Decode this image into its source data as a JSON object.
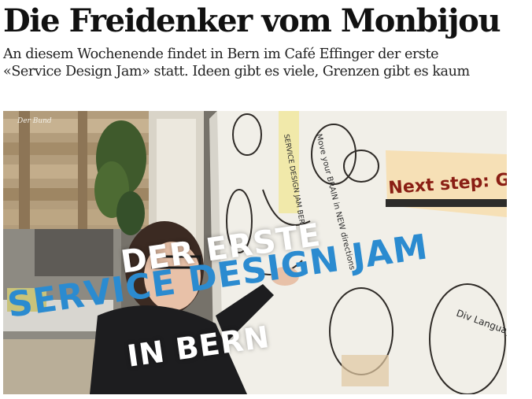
{
  "article": {
    "headline": "Die Freidenker vom Monbijou",
    "lead_line1": "An diesem Wochenende findet in Bern im Café Effinger der erste",
    "lead_line2": "«Service Design Jam» statt. Ideen gibt es viele, Grenzen gibt es kaum"
  },
  "video": {
    "logo": "Der Bund",
    "overlay_line1": "DER ERSTE",
    "overlay_line2": "SERVICE DESIGN JAM",
    "overlay_line3": "IN BERN",
    "board_title": "SERVICE DESIGN JAM BERN",
    "board_next_step": "Next step: Go out",
    "board_brain": "Move your BRAIN in NEW directions",
    "board_language": "Div Language",
    "colors": {
      "overlay_blue": "#2b8bd0",
      "overlay_white": "#ffffff"
    }
  }
}
